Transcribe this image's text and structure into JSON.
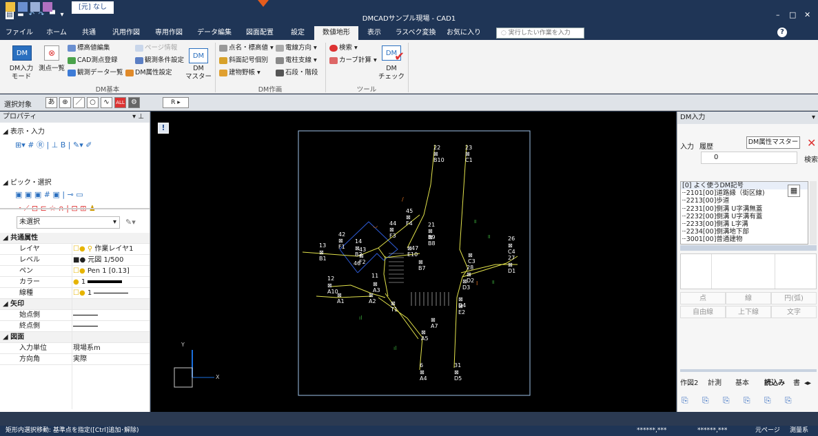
{
  "app": {
    "title": "DMCADサンプル現場 - CAD1",
    "qa_icons": [
      "app-icon",
      "save-icon",
      "undo-icon",
      "redo-icon",
      "print-icon",
      "customize-icon"
    ]
  },
  "menu": {
    "tabs": [
      "ファイル",
      "ホーム",
      "共通",
      "汎用作図",
      "専用作図",
      "データ編集",
      "図面配置",
      "設定",
      "数値地形",
      "表示",
      "ラスベク変換",
      "お気に入り"
    ],
    "active": "数値地形",
    "search_placeholder": "実行したい作業を入力"
  },
  "ribbon": {
    "dm_input_big": "DM",
    "dm_input_label": "DM入力\nモード",
    "survey_list": "測点一覧",
    "elev_edit": "標高値編集",
    "page_info": "ページ情報",
    "cad_register": "CAD測点登録",
    "obs_condition": "観測条件設定",
    "obs_data_list": "観測データ一覧",
    "dm_attr_set": "DM属性設定",
    "dm_master_big": "DM",
    "dm_master_label": "DM\nマスター",
    "point_name": "点名・標高値",
    "wire_dir": "電線方向",
    "slope_symbol": "斜面記号個別",
    "pole_line": "電柱支線",
    "building_field": "建物野帳",
    "stone_step": "石段・階段",
    "search": "検索",
    "curve_calc": "カーブ計算",
    "dm_check_big": "DM",
    "dm_check_label": "DM\nチェック",
    "groups": [
      "DM基本",
      "DM作画",
      "ツール"
    ]
  },
  "selectbar": {
    "label": "選択対象",
    "buttons": [
      "あ",
      "⊕",
      "／",
      "○",
      "∿",
      "ALL",
      "⚙"
    ],
    "r_button": "R"
  },
  "properties": {
    "title": "プロパティ",
    "sec_display": "表示・入力",
    "sec_pick": "ピック・選択",
    "selection": "未選択",
    "group_common": "共通属性",
    "rows": [
      {
        "k": "レイヤ",
        "v": "作業レイヤ1"
      },
      {
        "k": "レベル",
        "v": "元図 1/500"
      },
      {
        "k": "ペン",
        "v": "Pen 1 [0.13]"
      },
      {
        "k": "カラー",
        "v": "1"
      },
      {
        "k": "線種",
        "v": "1"
      }
    ],
    "group_arrow": "矢印",
    "arrow_rows": [
      {
        "k": "始点側",
        "v": ""
      },
      {
        "k": "終点側",
        "v": ""
      }
    ],
    "group_drawing": "図面",
    "drawing_rows": [
      {
        "k": "入力単位",
        "v": "現場系m"
      },
      {
        "k": "方向角",
        "v": "実際"
      }
    ]
  },
  "canvas": {
    "axis_x": "Y",
    "axis_y": "X",
    "labels": [
      {
        "t": "22"
      },
      {
        "t": "B10"
      },
      {
        "t": "23"
      },
      {
        "t": "C1"
      },
      {
        "t": "45"
      },
      {
        "t": "F4"
      },
      {
        "t": "42"
      },
      {
        "t": "F1"
      },
      {
        "t": "44"
      },
      {
        "t": "F3"
      },
      {
        "t": "43"
      },
      {
        "t": "F2"
      },
      {
        "t": "21"
      },
      {
        "t": "B9"
      },
      {
        "t": "B8"
      },
      {
        "t": "47"
      },
      {
        "t": "B7"
      },
      {
        "t": "14"
      },
      {
        "t": "B2"
      },
      {
        "t": "13"
      },
      {
        "t": "B1"
      },
      {
        "t": "E10"
      },
      {
        "t": "26"
      },
      {
        "t": "C4"
      },
      {
        "t": "C3"
      },
      {
        "t": "27"
      },
      {
        "t": "D1"
      },
      {
        "t": "28"
      },
      {
        "t": "D2"
      },
      {
        "t": "D3"
      },
      {
        "t": "D4"
      },
      {
        "t": "E2"
      },
      {
        "t": "46"
      },
      {
        "t": "12"
      },
      {
        "t": "A10"
      },
      {
        "t": "11"
      },
      {
        "t": "A3"
      },
      {
        "t": "A1"
      },
      {
        "t": "A2"
      },
      {
        "t": "T1"
      },
      {
        "t": "A7"
      },
      {
        "t": "A5"
      },
      {
        "t": "6"
      },
      {
        "t": "A4"
      },
      {
        "t": "31"
      },
      {
        "t": "D5"
      }
    ]
  },
  "dm_panel": {
    "title": "DM入力",
    "tab_input": "入力",
    "tab_history": "履歴",
    "attr_master_btn": "DM属性マスター",
    "code_value": "0",
    "search_btn": "検索",
    "list_header": "[0] よく使うDM記号",
    "list": [
      "2101[00]道路縁（街区線)",
      "2213[00]歩道",
      "2231[00]側溝 U字溝無蓋",
      "2232[00]側溝 U字溝有蓋",
      "2233[00]側溝 L字溝",
      "2234[00]側溝地下部",
      "3001[00]普通建物"
    ],
    "mode_buttons": [
      "点",
      "線",
      "円(弧)",
      "自由線",
      "上下線",
      "文字"
    ],
    "bottom_tabs": [
      "作図2",
      "計測",
      "基本",
      "読込み",
      "書"
    ]
  },
  "bottombar": {
    "tab": "[元] なし"
  },
  "status": {
    "left": "矩形内選択移動: 基準点を指定([Ctrl]追加･解除)",
    "c1": "******,***",
    "c2": "******,***",
    "page": "元ページ",
    "coord": "測量系"
  }
}
